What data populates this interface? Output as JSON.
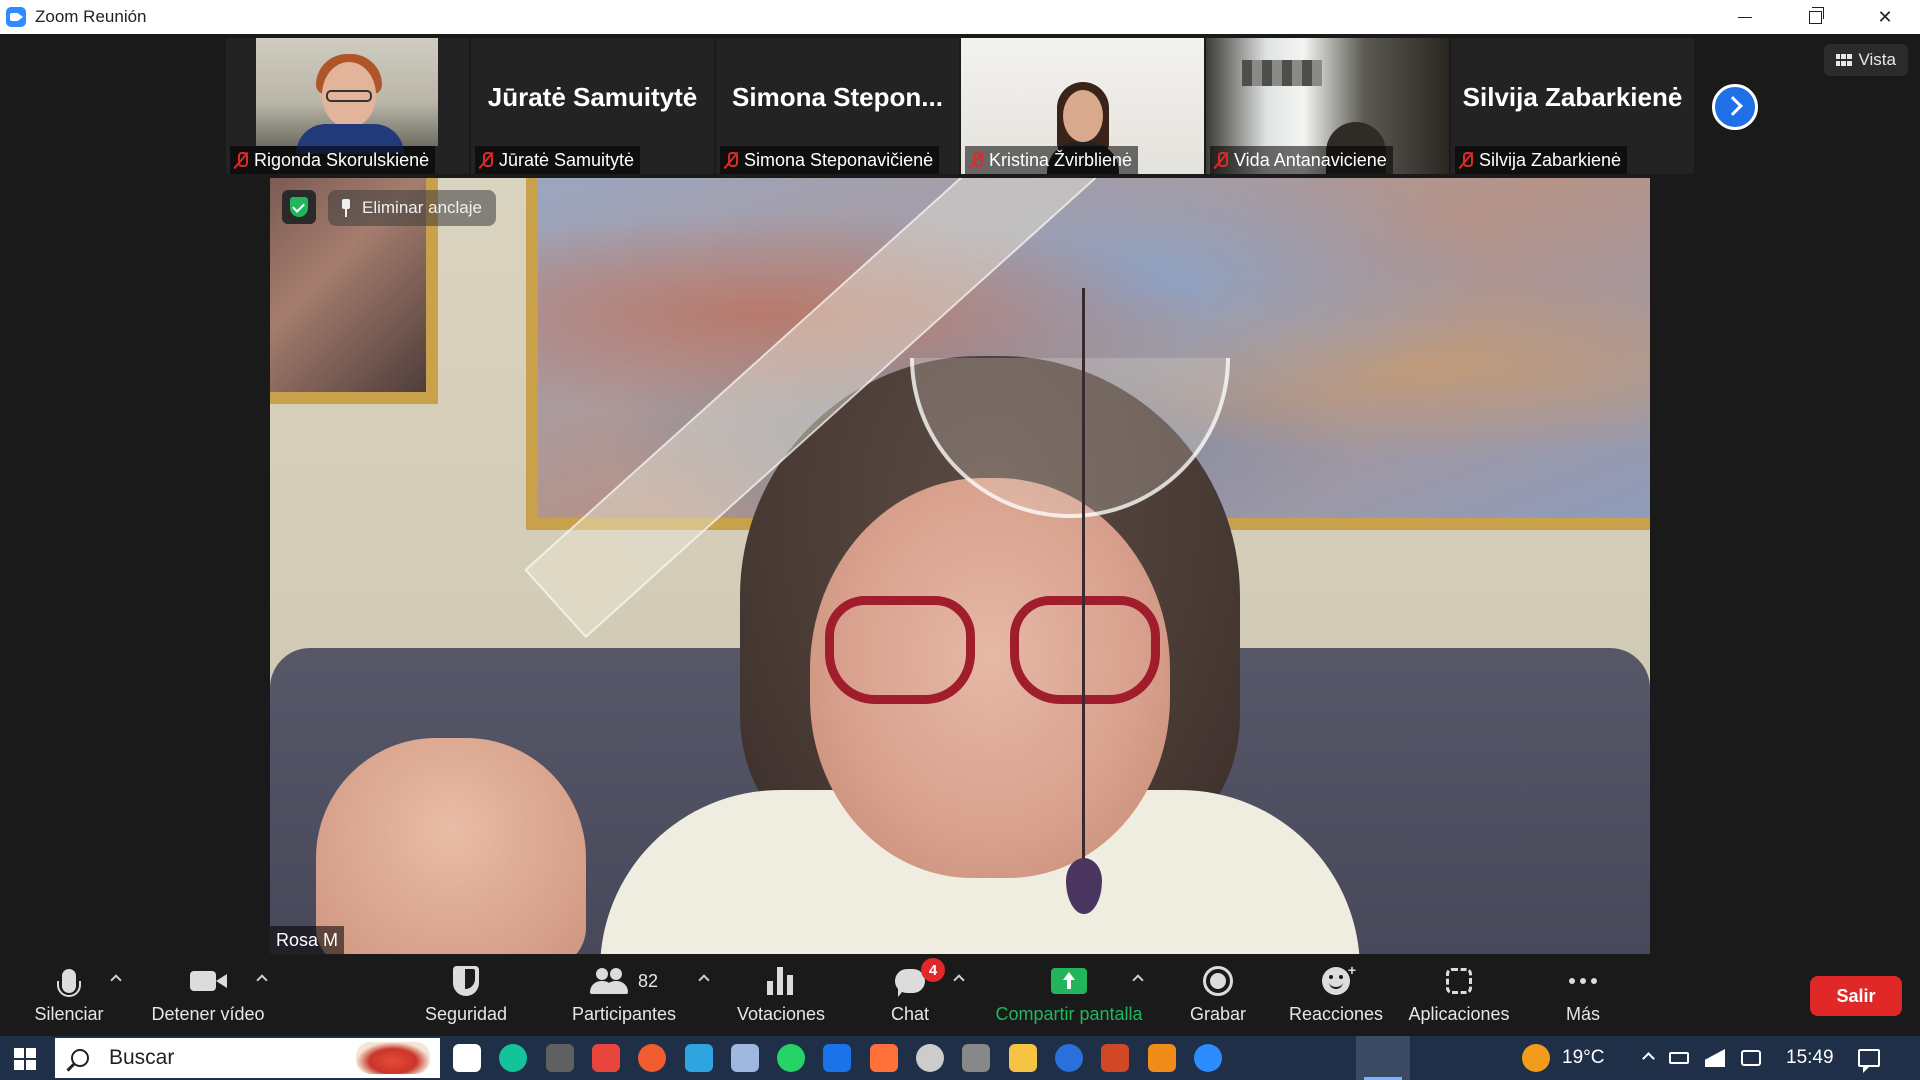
{
  "window": {
    "title": "Zoom Reunión"
  },
  "view_button": {
    "label": "Vista"
  },
  "participants_strip": [
    {
      "name": "Rigonda Skorulskienė",
      "has_video": true,
      "muted": true
    },
    {
      "name": "Jūratė Samuitytė",
      "display_name": "Jūratė Samuitytė",
      "has_video": false,
      "muted": true
    },
    {
      "name": "Simona Steponavičienė",
      "display_name": "Simona  Stepon...",
      "has_video": false,
      "muted": true
    },
    {
      "name": "Kristina Žvirblienė",
      "has_video": true,
      "muted": true
    },
    {
      "name": "Vida Antanaviciene",
      "has_video": true,
      "muted": true
    },
    {
      "name": "Silvija Zabarkienė",
      "display_name": "Silvija Zabarkienė",
      "has_video": false,
      "muted": true
    }
  ],
  "main_video": {
    "speaker": "Rosa M",
    "unpin_label": "Eliminar anclaje"
  },
  "toolbar": {
    "mute": "Silenciar",
    "video": "Detener vídeo",
    "security": "Seguridad",
    "participants": "Participantes",
    "participants_count": "82",
    "polls": "Votaciones",
    "chat": "Chat",
    "chat_badge": "4",
    "share": "Compartir pantalla",
    "record": "Grabar",
    "reactions": "Reacciones",
    "apps": "Aplicaciones",
    "more": "Más",
    "leave": "Salir"
  },
  "colors": {
    "share_green": "#23b55b",
    "leave_red": "#e02828",
    "zoom_blue": "#2d8cff"
  },
  "taskbar": {
    "search_label": "Buscar",
    "temperature": "19°C",
    "time": "15:49",
    "pinned_apps": [
      {
        "name": "task-view-icon",
        "color": "#ffffff"
      },
      {
        "name": "grammarly-icon",
        "color": "#15c39a"
      },
      {
        "name": "app-dark-icon",
        "color": "#606060"
      },
      {
        "name": "chrome-icon",
        "color": "#e8453c"
      },
      {
        "name": "colorful-app-icon",
        "color": "#f25c2f"
      },
      {
        "name": "edge-icon",
        "color": "#2fa5e0"
      },
      {
        "name": "scanner-icon",
        "color": "#9fb8e0"
      },
      {
        "name": "whatsapp-icon",
        "color": "#25d366"
      },
      {
        "name": "teamviewer-icon",
        "color": "#1a73e8"
      },
      {
        "name": "firefox-icon",
        "color": "#ff7139"
      },
      {
        "name": "inkscape-icon",
        "color": "#cccccc"
      },
      {
        "name": "app-gray-icon",
        "color": "#888888"
      },
      {
        "name": "file-explorer-icon",
        "color": "#f6c343"
      },
      {
        "name": "app-blue-icon",
        "color": "#2a6fdb"
      },
      {
        "name": "powerpoint-icon",
        "color": "#d24726"
      },
      {
        "name": "vlc-icon",
        "color": "#f08c1a"
      },
      {
        "name": "zoom-icon",
        "color": "#2d8cff"
      }
    ]
  }
}
